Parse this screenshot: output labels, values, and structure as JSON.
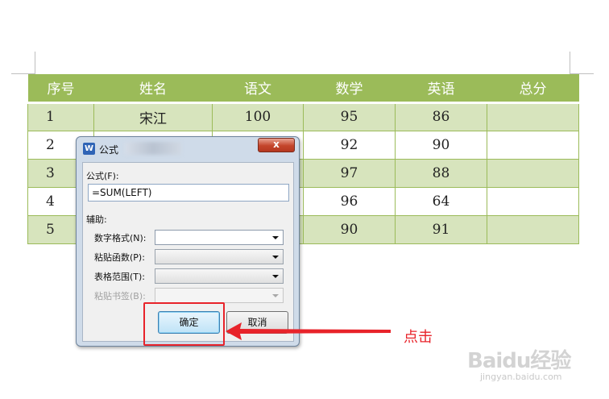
{
  "table": {
    "headers": [
      "序号",
      "姓名",
      "语文",
      "数学",
      "英语",
      "总分"
    ],
    "rows": [
      [
        "1",
        "宋江",
        "100",
        "95",
        "86",
        ""
      ],
      [
        "2",
        "",
        "",
        "92",
        "90",
        ""
      ],
      [
        "3",
        "",
        "",
        "97",
        "88",
        ""
      ],
      [
        "4",
        "",
        "",
        "96",
        "64",
        ""
      ],
      [
        "5",
        "",
        "",
        "90",
        "91",
        ""
      ]
    ]
  },
  "dialog": {
    "app_icon_label": "W",
    "title": "公式",
    "close_label": "x",
    "formula_label": "公式(F):",
    "formula_value": "=SUM(LEFT)",
    "assist_label": "辅助:",
    "number_format_label": "数字格式(N):",
    "paste_function_label": "粘贴函数(P):",
    "table_range_label": "表格范围(T):",
    "paste_bookmark_label": "粘贴书签(B):",
    "ok_label": "确定",
    "cancel_label": "取消"
  },
  "annotation": {
    "callout_text": "点击",
    "highlight_color": "#e8232a"
  },
  "watermark": {
    "main": "Baidu经验",
    "sub": "jingyan.baidu.com"
  },
  "colors": {
    "header_bg": "#9bbb59",
    "band_bg": "#d7e4bd",
    "dialog_bg": "#cfdbe9"
  },
  "icons": {
    "app_icon": "wps-writer-icon",
    "close_icon": "close-icon",
    "dropdown_icon": "chevron-down-icon",
    "arrow": "red-arrow-left-icon"
  }
}
